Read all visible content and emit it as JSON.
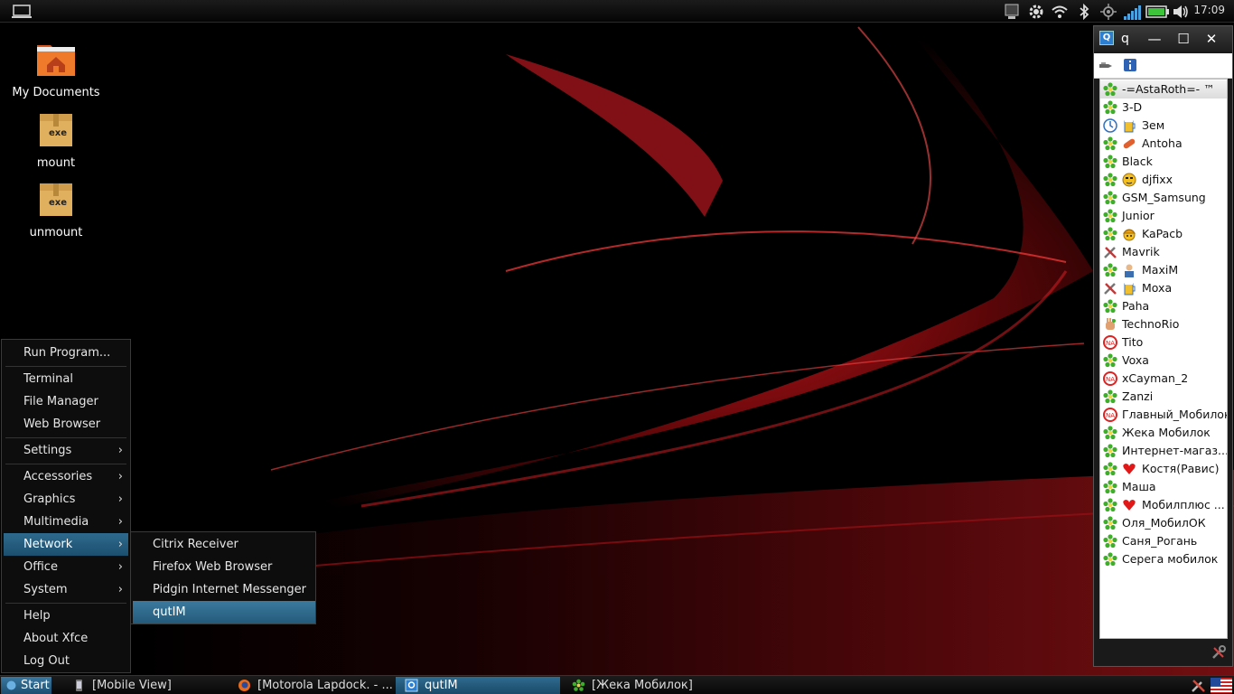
{
  "top_panel": {
    "clock": "17:09",
    "tray_icons": [
      "monitor-icon",
      "gear-icon",
      "wifi-icon",
      "bluetooth-icon",
      "gps-icon",
      "signal-icon",
      "battery-icon",
      "volume-icon"
    ]
  },
  "desktop": {
    "icons": [
      {
        "label": "My Documents",
        "icon": "home-folder-icon"
      },
      {
        "label": "mount",
        "icon": "exe-package-icon",
        "badge": "exe"
      },
      {
        "label": "unmount",
        "icon": "exe-package-icon",
        "badge": "exe"
      }
    ]
  },
  "start_menu": {
    "items": [
      {
        "label": "Run Program...",
        "submenu": false
      },
      {
        "label": "Terminal",
        "submenu": false
      },
      {
        "label": "File Manager",
        "submenu": false
      },
      {
        "label": "Web Browser",
        "submenu": false
      },
      {
        "label": "Settings",
        "submenu": true
      },
      {
        "label": "Accessories",
        "submenu": true
      },
      {
        "label": "Graphics",
        "submenu": true
      },
      {
        "label": "Multimedia",
        "submenu": true
      },
      {
        "label": "Network",
        "submenu": true,
        "active": true
      },
      {
        "label": "Office",
        "submenu": true
      },
      {
        "label": "System",
        "submenu": true
      },
      {
        "label": "Help",
        "submenu": false
      },
      {
        "label": "About Xfce",
        "submenu": false
      },
      {
        "label": "Log Out",
        "submenu": false
      }
    ],
    "arrow_glyph": "›"
  },
  "network_submenu": {
    "items": [
      {
        "label": "Citrix Receiver"
      },
      {
        "label": "Firefox Web Browser"
      },
      {
        "label": "Pidgin Internet Messenger"
      },
      {
        "label": "qutIM",
        "active": true
      }
    ]
  },
  "qutim": {
    "title": "q",
    "app_icon_letter": "Q",
    "buttons": {
      "minimize": "—",
      "maximize": "☐",
      "close": "✕"
    },
    "contacts": [
      {
        "name": "-=AstaRoth=- ™",
        "status": "online-icon"
      },
      {
        "name": "3-D",
        "status": "online-icon"
      },
      {
        "name": "Зем",
        "status": "away-clock-icon",
        "extra": "beer-icon"
      },
      {
        "name": "Antoha",
        "status": "online-icon",
        "extra": "pill-icon"
      },
      {
        "name": "Black",
        "status": "online-icon"
      },
      {
        "name": "djfixx",
        "status": "online-icon",
        "extra": "smiley-icon"
      },
      {
        "name": "GSM_Samsung",
        "status": "online-icon"
      },
      {
        "name": "Junior",
        "status": "online-icon"
      },
      {
        "name": "KaPacb",
        "status": "online-icon",
        "extra": "worker-icon"
      },
      {
        "name": "Mavrik",
        "status": "tools-icon"
      },
      {
        "name": "MaxiM",
        "status": "online-icon",
        "extra": "person-icon"
      },
      {
        "name": "Moxa",
        "status": "tools-icon",
        "extra": "beer-icon"
      },
      {
        "name": "Paha",
        "status": "online-icon"
      },
      {
        "name": "TechnoRio",
        "status": "hand-icon"
      },
      {
        "name": "Tito",
        "status": "not-available-icon"
      },
      {
        "name": "Voxa",
        "status": "online-icon"
      },
      {
        "name": "xCayman_2",
        "status": "not-available-icon"
      },
      {
        "name": "Zanzi",
        "status": "online-icon"
      },
      {
        "name": "Главный_Мобилок",
        "status": "not-available-icon"
      },
      {
        "name": "Жека Мобилок",
        "status": "online-icon"
      },
      {
        "name": "Интернет-магаз...",
        "status": "online-icon"
      },
      {
        "name": "Костя(Равис)",
        "status": "online-icon",
        "extra": "heart-icon"
      },
      {
        "name": "Маша",
        "status": "online-icon"
      },
      {
        "name": "Мобилплюс ...",
        "status": "online-icon",
        "extra": "heart-icon"
      },
      {
        "name": "Оля_МобилОК",
        "status": "online-icon"
      },
      {
        "name": "Саня_Рогань",
        "status": "online-icon"
      },
      {
        "name": "Серега мобилок",
        "status": "online-icon"
      }
    ]
  },
  "taskbar": {
    "start_label": "Start",
    "tasks": [
      {
        "label": "[Mobile View]",
        "icon": "phone-icon",
        "active": false
      },
      {
        "label": "[Motorola Lapdock. - ...",
        "icon": "firefox-icon",
        "active": false
      },
      {
        "label": "qutIM",
        "icon": "qutim-icon",
        "active": true
      },
      {
        "label": "[Жека Мобилок]",
        "icon": "icq-flower-icon",
        "active": false
      }
    ],
    "tray": [
      "tools-icon",
      "us-flag-icon"
    ]
  },
  "colors": {
    "menu_highlight": "#2e6a8e",
    "wallpaper_red": "#c8141a",
    "online_green": "#3fae2a"
  }
}
